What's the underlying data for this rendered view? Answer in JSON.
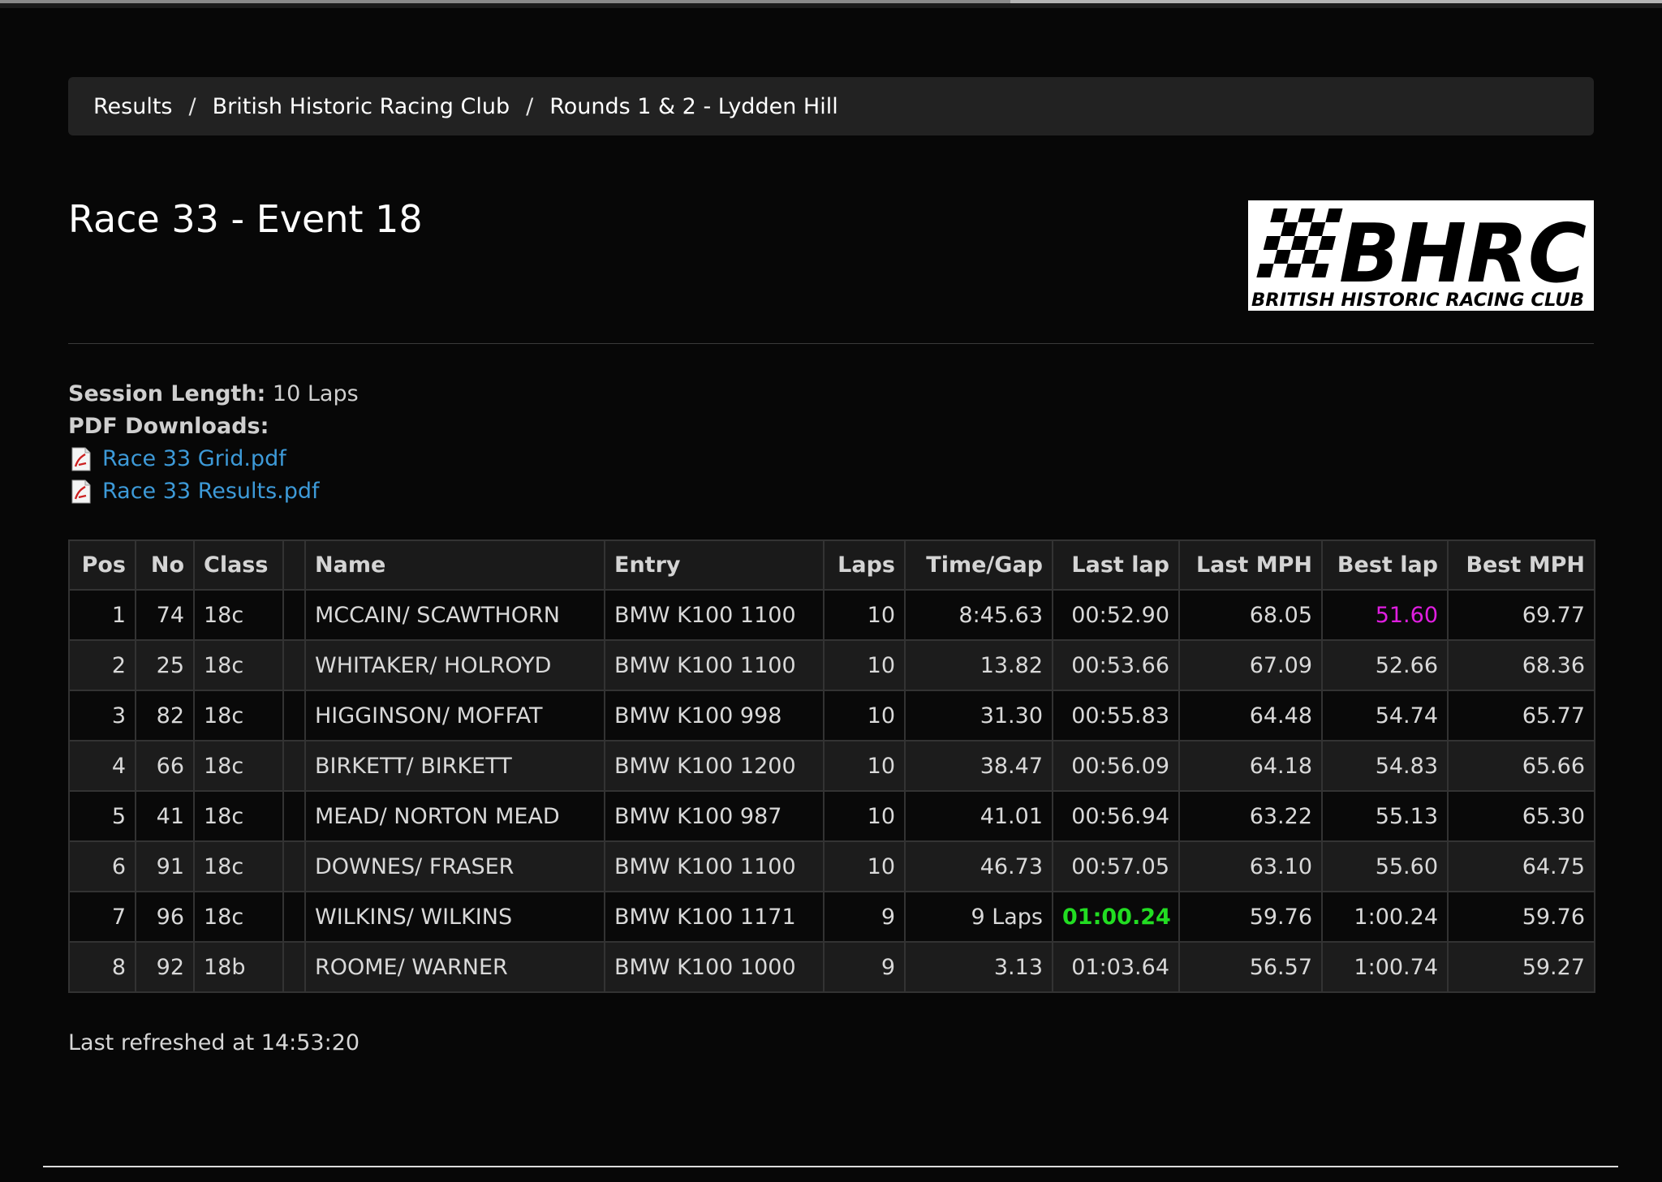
{
  "breadcrumb": [
    {
      "label": "Results"
    },
    {
      "label": "British Historic Racing Club"
    },
    {
      "label": "Rounds 1 & 2 - Lydden Hill"
    }
  ],
  "breadcrumb_separator": "/",
  "page_title": "Race 33 - Event 18",
  "logo": {
    "name": "BHRC",
    "text": "BHRC",
    "subtext": "BRITISH HISTORIC RACING CLUB"
  },
  "session": {
    "length_label": "Session Length:",
    "length_value": "10 Laps",
    "downloads_label": "PDF Downloads:",
    "downloads": [
      {
        "label": "Race 33 Grid.pdf",
        "icon": "pdf-icon"
      },
      {
        "label": "Race 33 Results.pdf",
        "icon": "pdf-icon"
      }
    ]
  },
  "colors": {
    "best_lap": "#e01ee0",
    "last_lap_best": "#22dd22",
    "link": "#3d9ad8"
  },
  "table": {
    "headers": [
      "Pos",
      "No",
      "Class",
      "",
      "Name",
      "Entry",
      "Laps",
      "Time/Gap",
      "Last lap",
      "Last MPH",
      "Best lap",
      "Best MPH"
    ],
    "rows": [
      [
        "1",
        "74",
        "18c",
        "",
        "MCCAIN/ SCAWTHORN",
        "BMW K100 1100",
        "10",
        "8:45.63",
        "00:52.90",
        "68.05",
        "51.60",
        "69.77"
      ],
      [
        "2",
        "25",
        "18c",
        "",
        "WHITAKER/ HOLROYD",
        "BMW K100 1100",
        "10",
        "13.82",
        "00:53.66",
        "67.09",
        "52.66",
        "68.36"
      ],
      [
        "3",
        "82",
        "18c",
        "",
        "HIGGINSON/ MOFFAT",
        "BMW K100 998",
        "10",
        "31.30",
        "00:55.83",
        "64.48",
        "54.74",
        "65.77"
      ],
      [
        "4",
        "66",
        "18c",
        "",
        "BIRKETT/ BIRKETT",
        "BMW K100 1200",
        "10",
        "38.47",
        "00:56.09",
        "64.18",
        "54.83",
        "65.66"
      ],
      [
        "5",
        "41",
        "18c",
        "",
        "MEAD/ NORTON MEAD",
        "BMW K100 987",
        "10",
        "41.01",
        "00:56.94",
        "63.22",
        "55.13",
        "65.30"
      ],
      [
        "6",
        "91",
        "18c",
        "",
        "DOWNES/ FRASER",
        "BMW K100 1100",
        "10",
        "46.73",
        "00:57.05",
        "63.10",
        "55.60",
        "64.75"
      ],
      [
        "7",
        "96",
        "18c",
        "",
        "WILKINS/ WILKINS",
        "BMW K100 1171",
        "9",
        "9 Laps",
        "01:00.24",
        "59.76",
        "1:00.24",
        "59.76"
      ],
      [
        "8",
        "92",
        "18b",
        "",
        "ROOME/ WARNER",
        "BMW K100 1000",
        "9",
        "3.13",
        "01:03.64",
        "56.57",
        "1:00.74",
        "59.27"
      ]
    ],
    "highlight": [
      {
        "row": 0,
        "col": 10,
        "style": "best"
      },
      {
        "row": 6,
        "col": 8,
        "style": "lastbest"
      }
    ]
  },
  "refreshed": "Last refreshed at 14:53:20"
}
